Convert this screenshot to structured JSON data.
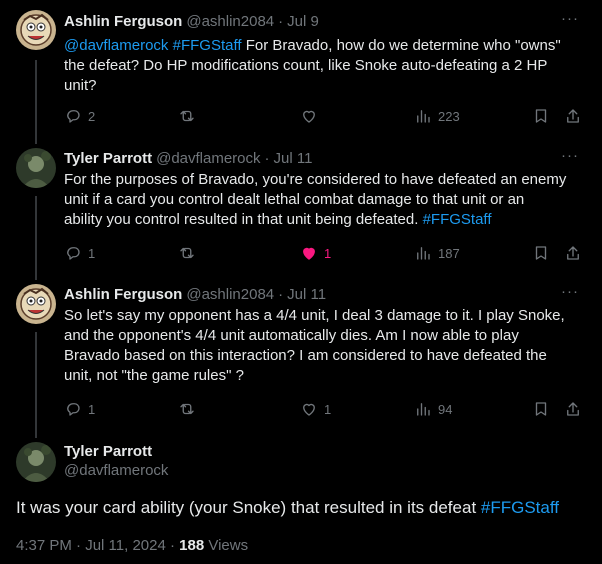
{
  "tweets": [
    {
      "name": "Ashlin Ferguson",
      "handle": "@ashlin2084",
      "time": "Jul 9",
      "mentions": "@davflamerock",
      "hashtag": "#FFGStaff",
      "text_line1_rest": " For Bravado, how do we determine who \"owns\"",
      "text_line2": "the defeat? Do HP modifications count, like Snoke auto-defeating a 2 HP",
      "text_line3": "unit?",
      "replies": "2",
      "reposts": "",
      "likes": "",
      "views": "223"
    },
    {
      "name": "Tyler Parrott",
      "handle": "@davflamerock",
      "time": "Jul 11",
      "text_line1": "For the purposes of Bravado, you're considered to have defeated an enemy",
      "text_line2": "unit if a card you control dealt lethal combat damage to that unit or an",
      "text_line3": "ability you control resulted in that unit being defeated. ",
      "hashtag": "#FFGStaff",
      "replies": "1",
      "reposts": "",
      "likes": "1",
      "views": "187"
    },
    {
      "name": "Ashlin Ferguson",
      "handle": "@ashlin2084",
      "time": "Jul 11",
      "text_line1": "So let's say my opponent has a 4/4 unit, I deal 3 damage to it. I play Snoke,",
      "text_line2": "and the opponent's 4/4 unit automatically dies. Am I now able to play",
      "text_line3": "Bravado based on this interaction? I am considered to have defeated the",
      "text_line4": "unit, not \"the game rules\" ?",
      "replies": "1",
      "reposts": "",
      "likes": "1",
      "views": "94"
    }
  ],
  "focus": {
    "name": "Tyler Parrott",
    "handle": "@davflamerock",
    "text": "It was your card ability (your Snoke) that resulted in its defeat ",
    "hashtag": "#FFGStaff",
    "timestamp": "4:37 PM · Jul 11, 2024 · ",
    "views_count": "188",
    "views_label": " Views"
  },
  "colors": {
    "accent": "#1d9bf0",
    "like": "#f91880",
    "muted": "#71767b",
    "text": "#e7e9ea",
    "bg": "#000000"
  },
  "icons": [
    "reply-icon",
    "repost-icon",
    "like-icon",
    "views-icon",
    "bookmark-icon",
    "share-icon",
    "more-icon"
  ]
}
